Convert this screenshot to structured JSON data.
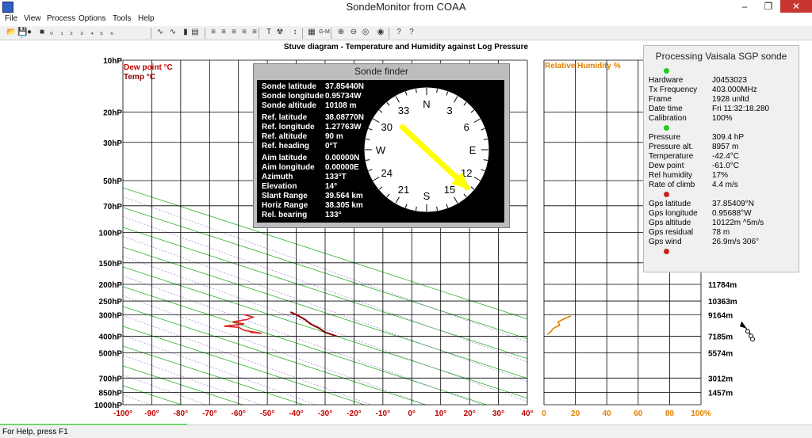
{
  "window": {
    "title": "SondeMonitor from COAA",
    "controls": {
      "minimize": "–",
      "maximize": "❐",
      "close": "✕"
    }
  },
  "menu": [
    "File",
    "View",
    "Process",
    "Options",
    "Tools",
    "Help"
  ],
  "toolbar": {
    "icons": [
      "open-icon",
      "save-icon",
      "record-icon",
      "stop-icon",
      "p1-icon",
      "p2-icon",
      "p3-icon",
      "p4-icon",
      "p5-icon",
      "p6-icon",
      "p7-icon",
      "wave-icon",
      "wave2-icon",
      "bar-icon",
      "box-icon",
      "lines-icon",
      "lines2-icon",
      "lines3-icon",
      "lines4-icon",
      "lines5-icon",
      "temp-icon",
      "radiation-icon",
      "vertical-arrow-icon",
      "map-icon",
      "gm-icon",
      "zoom-in-icon",
      "zoom-out-icon",
      "target-icon",
      "compass-icon",
      "help-icon",
      "context-help-icon"
    ],
    "glyphs": [
      "📂",
      "💾",
      "●",
      "■",
      "₀",
      "₁",
      "₂",
      "₃",
      "₄",
      "₅",
      "₆",
      "∿",
      "∿",
      "▮",
      "▤",
      "≡",
      "≡",
      "≡",
      "≡",
      "≡",
      "T",
      "☢",
      "↕",
      "▦",
      "G-M",
      "⊕",
      "⊖",
      "◎",
      "◉",
      "?",
      "?"
    ]
  },
  "diagram": {
    "title": "Stuve diagram - Temperature and Humidity against Log Pressure",
    "legend_dewpoint": "Dew point °C",
    "legend_temp": "Temp °C",
    "legend_color_dewpoint": "#c00000",
    "legend_color_temp": "#8b0000",
    "humidity_label": "Relative Humidity %",
    "humidity_color": "#e08000",
    "pressure_labels": [
      "10hP",
      "20hP",
      "30hP",
      "50hP",
      "70hP",
      "100hP",
      "150hP",
      "200hP",
      "250hP",
      "300hP",
      "400hP",
      "500hP",
      "700hP",
      "850hP",
      "1000hP"
    ],
    "pressure_values": [
      10,
      20,
      30,
      50,
      70,
      100,
      150,
      200,
      250,
      300,
      400,
      500,
      700,
      850,
      1000
    ],
    "temp_labels": [
      "-100°",
      "-90°",
      "-80°",
      "-70°",
      "-60°",
      "-50°",
      "-40°",
      "-30°",
      "-20°",
      "-10°",
      "0°",
      "10°",
      "20°",
      "30°",
      "40°"
    ],
    "humidity_labels": [
      "0",
      "20",
      "40",
      "60",
      "80",
      "100%"
    ],
    "altitude_labels": [
      "11784m",
      "10363m",
      "9164m",
      "7185m",
      "5574m",
      "3012m",
      "1457m"
    ],
    "altitude_pressures": [
      200,
      250,
      300,
      400,
      500,
      700,
      850
    ]
  },
  "finder": {
    "title": "Sonde finder",
    "rows": [
      {
        "k": "Sonde latitude",
        "v": "37.85440N"
      },
      {
        "k": "Sonde longitude",
        "v": "0.95734W"
      },
      {
        "k": "Sonde altitude",
        "v": "10108 m"
      },
      {
        "k": "Ref. latitude",
        "v": "38.08770N"
      },
      {
        "k": "Ref. longitude",
        "v": "1.27763W"
      },
      {
        "k": "Ref. altitude",
        "v": "90 m"
      },
      {
        "k": "Ref. heading",
        "v": "0°T"
      },
      {
        "k": "Aim latitude",
        "v": "0.00000N"
      },
      {
        "k": "Aim longitude",
        "v": "0.00000E"
      },
      {
        "k": "Azimuth",
        "v": "133°T"
      },
      {
        "k": "Elevation",
        "v": "14°"
      },
      {
        "k": "Slant Range",
        "v": "39.564 km"
      },
      {
        "k": "Horiz Range",
        "v": "38.305 km"
      },
      {
        "k": "Rel. bearing",
        "v": "133°"
      }
    ],
    "compass_labels": [
      "N",
      "3",
      "6",
      "E",
      "12",
      "15",
      "S",
      "21",
      "24",
      "W",
      "30",
      "33"
    ],
    "bearing_deg": 133
  },
  "processing": {
    "title": "Processing Vaisala SGP sonde",
    "rows": [
      {
        "k": "Hardware",
        "v": "J0453023"
      },
      {
        "k": "Tx Frequency",
        "v": "403.000MHz"
      },
      {
        "k": "Frame",
        "v": "1928 unltd"
      },
      {
        "k": "Date time",
        "v": "Fri 11:32:18.280"
      },
      {
        "k": "Calibration",
        "v": "100%"
      },
      {
        "k": "Pressure",
        "v": "309.4 hP"
      },
      {
        "k": "Pressure alt.",
        "v": "8957 m"
      },
      {
        "k": "Temperature",
        "v": "-42.4°C"
      },
      {
        "k": "Dew point",
        "v": "-61.0°C"
      },
      {
        "k": "Rel humidity",
        "v": "17%"
      },
      {
        "k": "Rate of climb",
        "v": "4.4 m/s"
      },
      {
        "k": "Gps latitude",
        "v": "37.85409°N"
      },
      {
        "k": "Gps longitude",
        "v": "0.95688°W"
      },
      {
        "k": "Gps altitude",
        "v": "10122m ^5m/s"
      },
      {
        "k": "Gps residual",
        "v": "78 m"
      },
      {
        "k": "Gps wind",
        "v": "26.9m/s 306°"
      }
    ],
    "leds": [
      {
        "status": "ok",
        "color": "#22cc22"
      },
      {
        "status": "ok",
        "color": "#22cc22"
      },
      {
        "status": "error",
        "color": "#cc2020"
      },
      {
        "status": "error",
        "color": "#cc2020"
      }
    ]
  },
  "status": {
    "text": "For Help, press F1",
    "progress": 0.23
  }
}
